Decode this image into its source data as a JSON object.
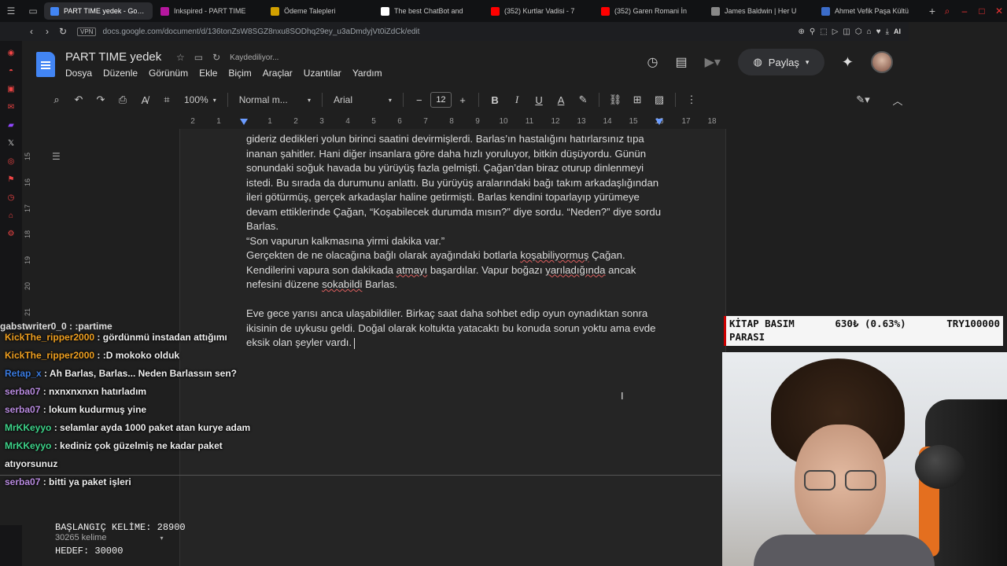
{
  "browser": {
    "tabs": [
      {
        "label": "PART TIME yedek - Google",
        "color": "#4285f4",
        "active": true
      },
      {
        "label": "Inkspired - PART TIME",
        "color": "#b5179e",
        "active": false
      },
      {
        "label": "Ödeme Talepleri",
        "color": "#d2a000",
        "active": false
      },
      {
        "label": "The best ChatBot and",
        "color": "#ffffff",
        "active": false
      },
      {
        "label": "(352) Kurtlar Vadisi - 7",
        "color": "#ff0000",
        "active": false
      },
      {
        "label": "(352) Garen Romani İn",
        "color": "#ff0000",
        "active": false
      },
      {
        "label": "James Baldwin | Her U",
        "color": "#888888",
        "active": false
      },
      {
        "label": "Ahmet Vefik Paşa Kültü",
        "color": "#3b6cc9",
        "active": false
      }
    ],
    "vpn": "VPN",
    "url": "docs.google.com/document/d/136tonZsW8SGZ8nxu8SODhq29ey_u3aDmdyjVt0iZdCk/edit",
    "ai_label": "AI"
  },
  "docs": {
    "title": "PART TIME  yedek",
    "saving": "Kaydediliyor...",
    "menu": [
      "Dosya",
      "Düzenle",
      "Görünüm",
      "Ekle",
      "Biçim",
      "Araçlar",
      "Uzantılar",
      "Yardım"
    ],
    "share_label": "Paylaş",
    "zoom": "100%",
    "style": "Normal m...",
    "font": "Arial",
    "font_size": "12",
    "ruler_numbers": [
      "2",
      "1",
      "1",
      "2",
      "3",
      "4",
      "5",
      "6",
      "7",
      "8",
      "9",
      "10",
      "11",
      "12",
      "13",
      "14",
      "15",
      "16",
      "17",
      "18"
    ],
    "vruler_numbers": [
      "15",
      "16",
      "17",
      "18",
      "19",
      "20",
      "21"
    ],
    "paragraphs": [
      "gideriz dedikleri yolun birinci saatini devirmişlerdi. Barlas’ın hastalığını hatırlarsınız tıpa inanan şahitler. Hani diğer insanlara göre daha hızlı yoruluyor, bitkin düşüyordu. Günün sonundaki soğuk havada bu yürüyüş fazla gelmişti. Çağan’dan biraz oturup dinlenmeyi istedi. Bu sırada da durumunu anlattı. Bu yürüyüş aralarındaki bağı takım arkadaşlığından ileri götürmüş, gerçek arkadaşlar haline getirmişti. Barlas kendini toparlayıp yürümeye devam ettiklerinde Çağan, “Koşabilecek durumda mısın?” diye sordu. “Neden?” diye sordu Barlas.",
      "“Son vapurun kalkmasına yirmi dakika var.”",
      "Gerçekten de ne olacağına bağlı olarak ayağındaki botlarla koşabiliyormuş Çağan. Kendilerini vapura son dakikada atmayı başardılar. Vapur boğazı yarıladığında ancak nefesini düzene sokabildi Barlas.",
      "",
      "Eve gece yarısı anca ulaşabildiler. Birkaç saat daha sohbet edip oyun oynadıktan sonra ikisinin de uykusu geldi. Doğal olarak koltukta yatacaktı bu konuda sorun yoktu ama evde eksik olan şeyler vardı."
    ]
  },
  "overlay": {
    "chat_clipped": "gabstwriter0_0 : :partime",
    "chat": [
      {
        "user": "KickThe_ripper2000",
        "color": "#f0a020",
        "text": "gördünmü instadan attığımı"
      },
      {
        "user": "KickThe_ripper2000",
        "color": "#f0a020",
        "text": ":D mokoko olduk"
      },
      {
        "user": "Retap_x",
        "color": "#3a7be0",
        "text": "Ah Barlas, Barlas... Neden Barlassın sen?"
      },
      {
        "user": "serba07",
        "color": "#b98be0",
        "text": "nxnxnxnxn hatırladım"
      },
      {
        "user": "serba07",
        "color": "#b98be0",
        "text": "lokum kudurmuş yine"
      },
      {
        "user": "MrKKeyyo",
        "color": "#3ed48a",
        "text": "selamlar ayda 1000 paket atan kurye adam"
      },
      {
        "user": "MrKKeyyo",
        "color": "#3ed48a",
        "text": "kediniz çok güzelmiş ne kadar paket atıyorsunuz"
      },
      {
        "user": "serba07",
        "color": "#b98be0",
        "text": "bitti ya paket işleri"
      }
    ],
    "start_words": "BAŞLANGIÇ KELİME: 28900",
    "word_count": "30265 kelime",
    "target": "HEDEF: 30000",
    "ticker_name": "KİTAP BASIM",
    "ticker_name2": "PARASI",
    "ticker_value": "630₺ (0.63%)",
    "ticker_goal": "TRY100000"
  }
}
